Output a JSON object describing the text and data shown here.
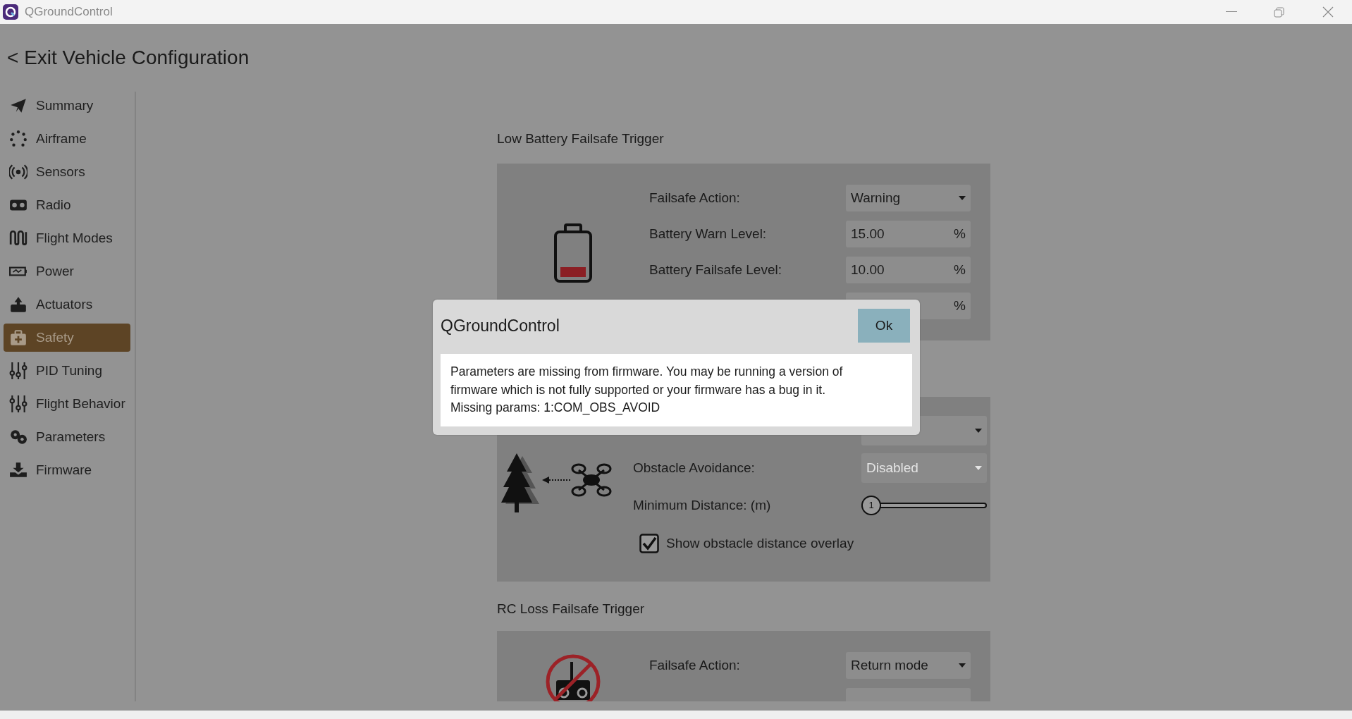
{
  "window": {
    "title": "QGroundControl"
  },
  "back_link": "< Exit Vehicle Configuration",
  "sidebar": {
    "items": [
      {
        "label": "Summary",
        "selected": false
      },
      {
        "label": "Airframe",
        "selected": false
      },
      {
        "label": "Sensors",
        "selected": false
      },
      {
        "label": "Radio",
        "selected": false
      },
      {
        "label": "Flight Modes",
        "selected": false
      },
      {
        "label": "Power",
        "selected": false
      },
      {
        "label": "Actuators",
        "selected": false
      },
      {
        "label": "Safety",
        "selected": true
      },
      {
        "label": "PID Tuning",
        "selected": false
      },
      {
        "label": "Flight Behavior",
        "selected": false
      },
      {
        "label": "Parameters",
        "selected": false
      },
      {
        "label": "Firmware",
        "selected": false
      }
    ]
  },
  "sections": [
    {
      "heading": "Low Battery Failsafe Trigger",
      "rows": [
        {
          "kind": "dropdown",
          "label": "Failsafe Action:",
          "value": "Warning",
          "disabled": false
        },
        {
          "kind": "number",
          "label": "Battery Warn Level:",
          "value": "15.00",
          "unit": "%"
        },
        {
          "kind": "number",
          "label": "Battery Failsafe Level:",
          "value": "10.00",
          "unit": "%"
        },
        {
          "kind": "number",
          "unit": "%"
        }
      ]
    },
    {
      "rows": [
        {
          "kind": "dropdown",
          "disabled": false
        },
        {
          "kind": "dropdown",
          "label": "Obstacle Avoidance:",
          "value": "Disabled",
          "disabled": true
        },
        {
          "kind": "slider",
          "label": "Minimum Distance: (m)",
          "value": "1",
          "level": 0
        },
        {
          "kind": "checkbox",
          "label": "Show obstacle distance overlay",
          "checked": true
        }
      ]
    },
    {
      "heading": "RC Loss Failsafe Trigger",
      "rows": [
        {
          "kind": "dropdown",
          "label": "Failsafe Action:",
          "value": "Return mode",
          "disabled": false
        },
        {
          "kind": "number"
        }
      ]
    }
  ],
  "dialog": {
    "title": "QGroundControl",
    "button": "Ok",
    "message": "Parameters are missing from firmware. You may be running a version of\nfirmware which is not fully supported or your firmware has a bug in it.\nMissing params: 1:COM_OBS_AVOID"
  }
}
